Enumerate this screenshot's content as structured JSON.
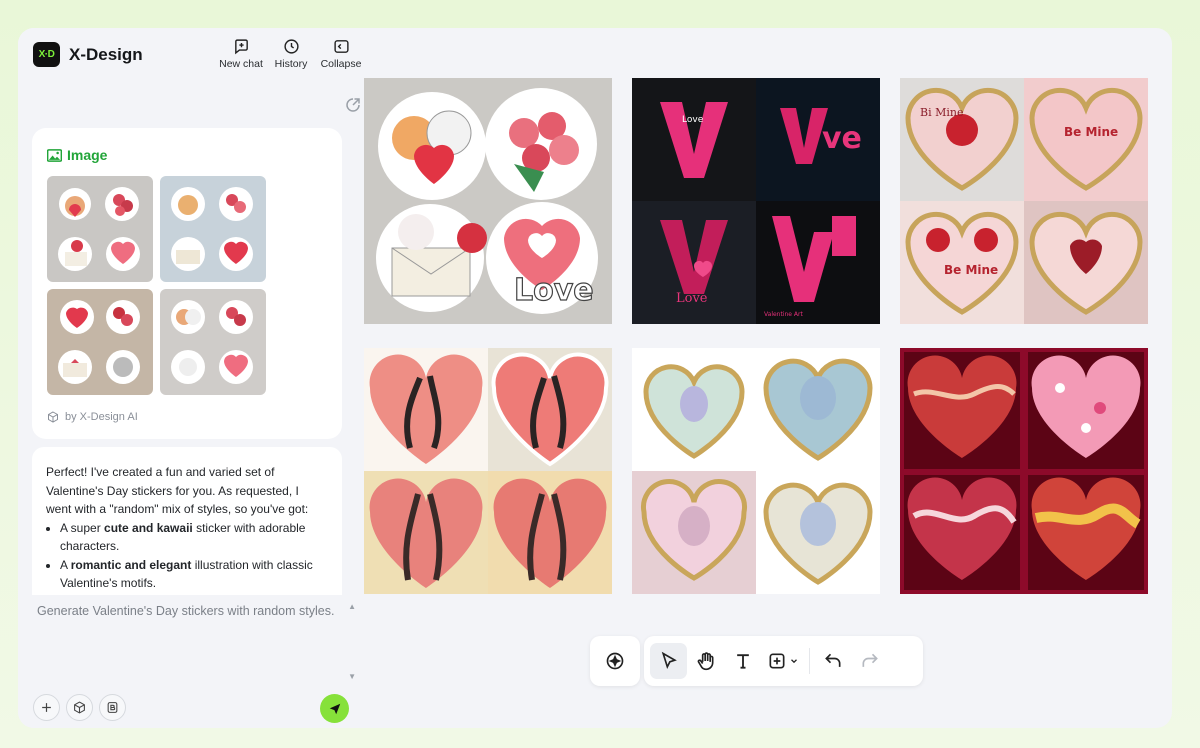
{
  "app": {
    "name": "X-Design",
    "logo_text": "X·D"
  },
  "header_actions": [
    {
      "label": "New chat",
      "icon": "new-chat-icon"
    },
    {
      "label": "History",
      "icon": "history-icon"
    },
    {
      "label": "Collapse",
      "icon": "collapse-icon"
    }
  ],
  "image_card": {
    "title": "Image",
    "attribution": "by X-Design AI"
  },
  "message": {
    "intro": "Perfect! I've created a fun and varied set of Valentine's Day stickers for you. As requested, I went with a \"random\" mix of styles, so you've got:",
    "bullets": [
      {
        "prefix": "A super ",
        "bold": "cute and kawaii",
        "suffix": " sticker with adorable characters."
      },
      {
        "prefix": "A ",
        "bold": "romantic and elegant",
        "suffix": " illustration with classic Valentine's motifs."
      }
    ]
  },
  "prompt_input": {
    "value": "Generate Valentine's Day stickers with random styles."
  },
  "canvas": {
    "tiles": [
      {
        "name": "kawaii-stickers",
        "texts": [
          "Love"
        ]
      },
      {
        "name": "love-typography",
        "texts": [
          "Love",
          "Love",
          "Valentine Art",
          "ve"
        ]
      },
      {
        "name": "embroidered-patches",
        "texts": [
          "Be Mine",
          "Bi Mine",
          "Be Mine"
        ]
      },
      {
        "name": "dancing-couple-hearts",
        "texts": []
      },
      {
        "name": "ornate-heart-brooches",
        "texts": []
      },
      {
        "name": "marble-hearts",
        "texts": []
      }
    ]
  },
  "toolbar": {
    "tools": [
      "ai-tool",
      "select-tool",
      "hand-tool",
      "text-tool",
      "insert-tool",
      "undo",
      "redo"
    ],
    "active": "select-tool"
  },
  "colors": {
    "accent": "#22a539",
    "send": "#86e13a",
    "brand_bg": "#111111"
  }
}
